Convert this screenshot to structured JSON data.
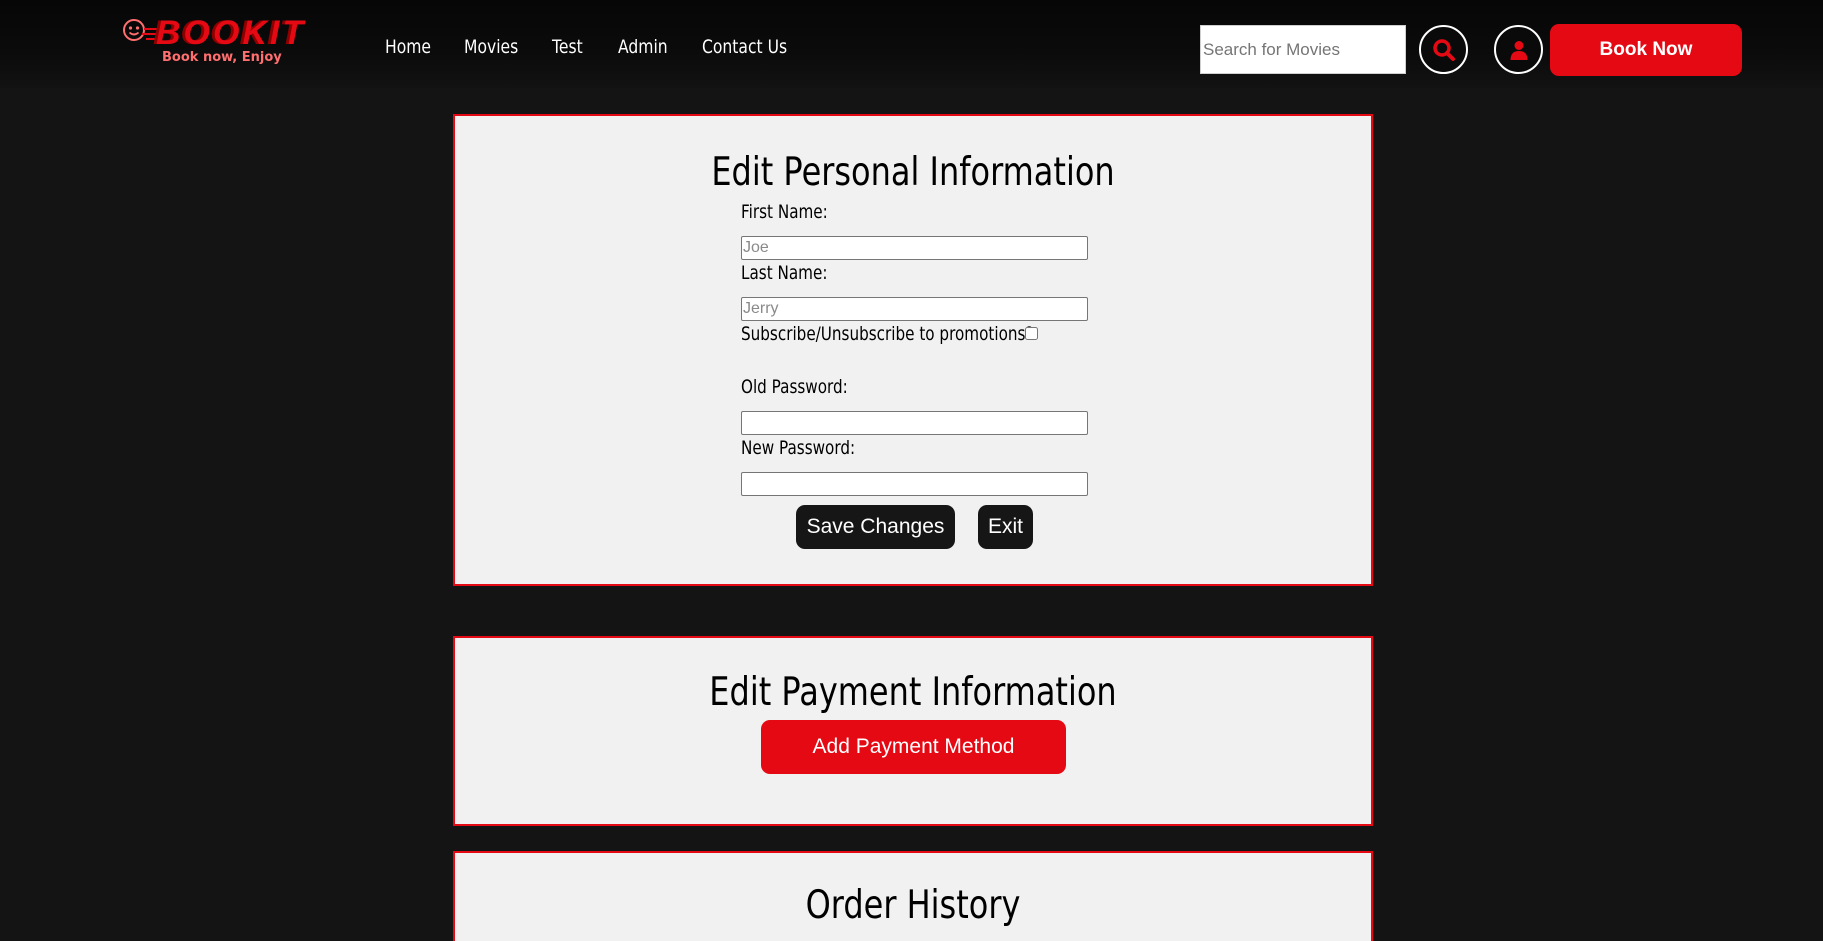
{
  "header": {
    "logo": {
      "brand": "BOOKIT",
      "tagline": "Book now, Enjoy",
      "icon": "smiley-icon",
      "color": "#e50914"
    },
    "nav": [
      "Home",
      "Movies",
      "Test",
      "Admin",
      "Contact Us"
    ],
    "search": {
      "placeholder": "Search for Movies",
      "value": ""
    },
    "search_icon": "magnifier-icon",
    "account_icon": "user-icon",
    "book_now_label": "Book Now"
  },
  "personal_info": {
    "title": "Edit Personal Information",
    "first_name_label": "First Name:",
    "first_name_placeholder": "Joe",
    "last_name_label": "Last Name:",
    "last_name_placeholder": "Jerry",
    "promotions_label": "Subscribe/Unsubscribe to promotions?",
    "promotions_checked": false,
    "old_password_label": "Old Password:",
    "new_password_label": "New Password:",
    "save_label": "Save Changes",
    "exit_label": "Exit"
  },
  "payment_info": {
    "title": "Edit Payment Information",
    "add_label": "Add Payment Method"
  },
  "order_history": {
    "title": "Order History"
  },
  "colors": {
    "accent": "#e50914",
    "background": "#141414",
    "panel": "#f1f1f1",
    "dark_button": "#161616"
  }
}
